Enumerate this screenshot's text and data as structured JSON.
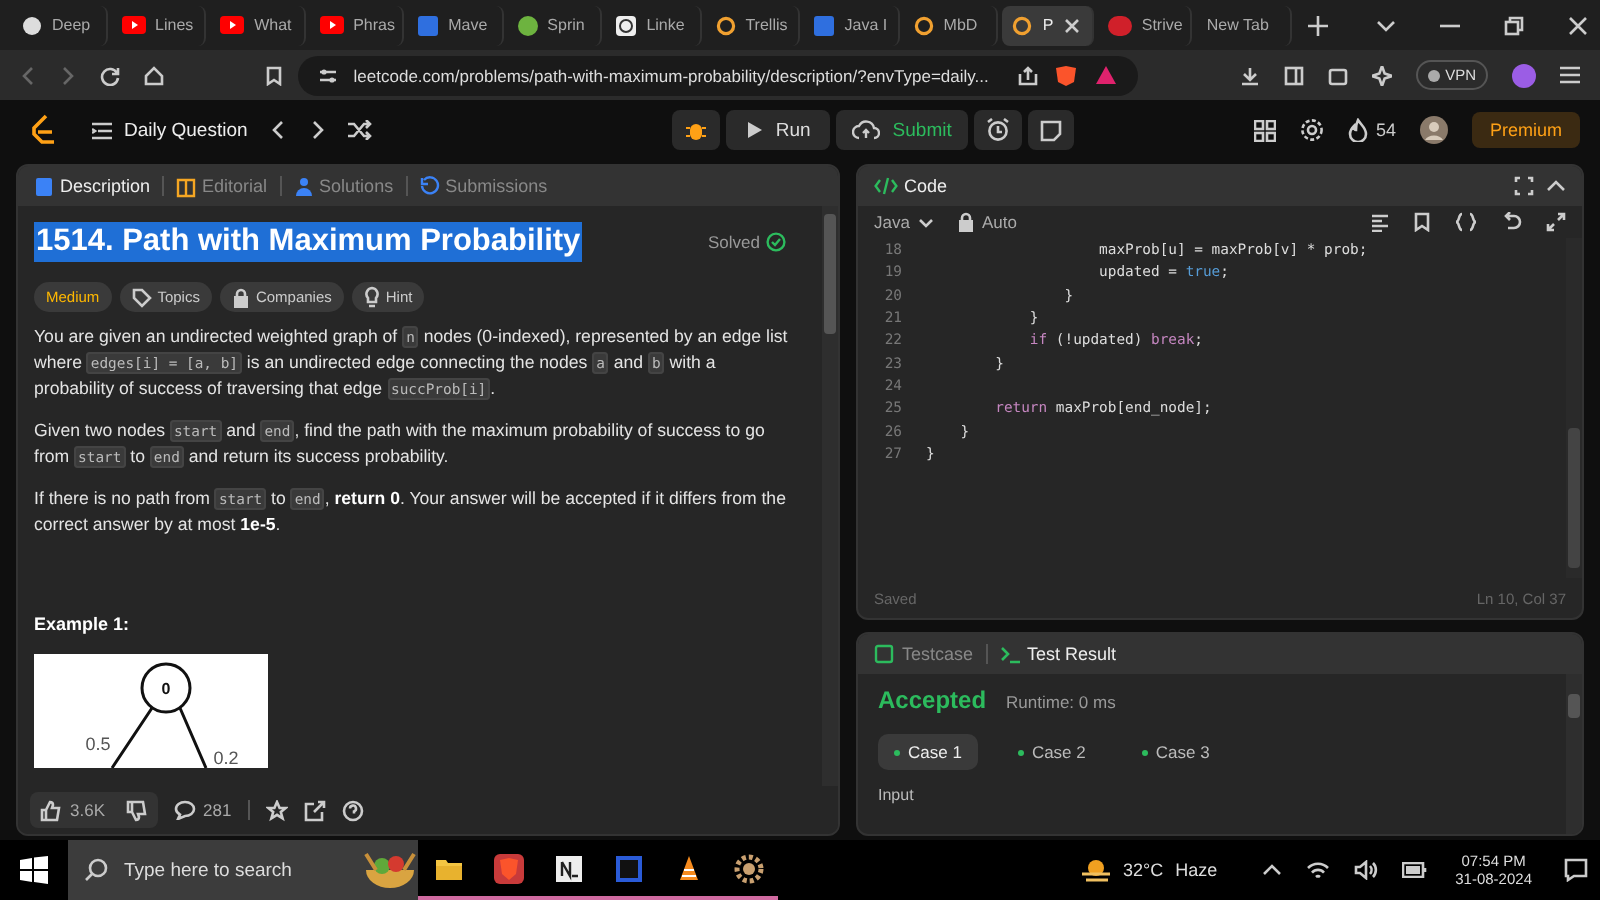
{
  "browser": {
    "tabs": [
      {
        "title": "Deep",
        "selected": false
      },
      {
        "title": "Lines",
        "selected": false
      },
      {
        "title": "What",
        "selected": false
      },
      {
        "title": "Phras",
        "selected": false
      },
      {
        "title": "Mave",
        "selected": false
      },
      {
        "title": "Sprin",
        "selected": false
      },
      {
        "title": "Linke",
        "selected": false
      },
      {
        "title": "Trellis",
        "selected": false
      },
      {
        "title": "Java I",
        "selected": false
      },
      {
        "title": "MbD",
        "selected": false
      },
      {
        "title": "P",
        "selected": true
      },
      {
        "title": "Strive",
        "selected": false
      },
      {
        "title": "New Tab",
        "selected": false
      }
    ],
    "url": "leetcode.com/problems/path-with-maximum-probability/description/?envType=daily...",
    "vpn": "VPN"
  },
  "nav": {
    "title": "Daily Question",
    "run": "Run",
    "submit": "Submit",
    "streak": "54",
    "premium": "Premium"
  },
  "description": {
    "tabs": [
      {
        "label": "Description",
        "selected": true
      },
      {
        "label": "Editorial",
        "selected": false
      },
      {
        "label": "Solutions",
        "selected": false
      },
      {
        "label": "Submissions",
        "selected": false
      }
    ],
    "title": "1514. Path with Maximum Probability",
    "status": "Solved",
    "tags": [
      {
        "label": "Medium",
        "kind": "difficulty"
      },
      {
        "label": "Topics",
        "kind": "topics"
      },
      {
        "label": "Companies",
        "kind": "companies"
      },
      {
        "label": "Hint",
        "kind": "hint"
      }
    ],
    "paragraphs": [
      [
        {
          "kind": "plain",
          "text": "You are given an undirected weighted graph of "
        },
        {
          "kind": "code",
          "text": "n"
        },
        {
          "kind": "plain",
          "text": " nodes (0-indexed), represented by an edge list where "
        },
        {
          "kind": "code",
          "text": "edges[i] = [a, b]"
        },
        {
          "kind": "plain",
          "text": " is an undirected edge connecting the nodes "
        },
        {
          "kind": "code",
          "text": "a"
        },
        {
          "kind": "plain",
          "text": " and "
        },
        {
          "kind": "code",
          "text": "b"
        },
        {
          "kind": "plain",
          "text": " with a probability of success of traversing that edge "
        },
        {
          "kind": "code",
          "text": "succProb[i]"
        },
        {
          "kind": "plain",
          "text": "."
        }
      ],
      [
        {
          "kind": "plain",
          "text": "Given two nodes "
        },
        {
          "kind": "code",
          "text": "start"
        },
        {
          "kind": "plain",
          "text": " and "
        },
        {
          "kind": "code",
          "text": "end"
        },
        {
          "kind": "plain",
          "text": ", find the path with the maximum probability of success to go from "
        },
        {
          "kind": "code",
          "text": "start"
        },
        {
          "kind": "plain",
          "text": " to "
        },
        {
          "kind": "code",
          "text": "end"
        },
        {
          "kind": "plain",
          "text": " and return its success probability."
        }
      ],
      [
        {
          "kind": "plain",
          "text": "If there is no path from "
        },
        {
          "kind": "code",
          "text": "start"
        },
        {
          "kind": "plain",
          "text": " to "
        },
        {
          "kind": "code",
          "text": "end"
        },
        {
          "kind": "plain",
          "text": ", "
        },
        {
          "kind": "bold",
          "text": "return 0"
        },
        {
          "kind": "plain",
          "text": ". Your answer will be accepted if it differs from the correct answer by at most "
        },
        {
          "kind": "bold",
          "text": "1e-5"
        },
        {
          "kind": "plain",
          "text": "."
        }
      ]
    ],
    "example_title": "Example 1:",
    "example_graph": {
      "node": "0",
      "left_weight": "0.5",
      "right_weight": "0.2"
    },
    "likes": "3.6K",
    "comments": "281"
  },
  "editor": {
    "title": "Code",
    "language": "Java",
    "mode": "Auto",
    "lines": [
      {
        "number": "18",
        "tokens": [
          {
            "kind": "plain",
            "text": "                    maxProb[u] = maxProb[v] * prob;"
          }
        ]
      },
      {
        "number": "19",
        "tokens": [
          {
            "kind": "plain",
            "text": "                    updated = "
          },
          {
            "kind": "literal",
            "text": "true"
          },
          {
            "kind": "plain",
            "text": ";"
          }
        ]
      },
      {
        "number": "20",
        "tokens": [
          {
            "kind": "plain",
            "text": "                }"
          }
        ]
      },
      {
        "number": "21",
        "tokens": [
          {
            "kind": "plain",
            "text": "            }"
          }
        ]
      },
      {
        "number": "22",
        "tokens": [
          {
            "kind": "keyword",
            "text": "            if"
          },
          {
            "kind": "plain",
            "text": " (!updated) "
          },
          {
            "kind": "keyword",
            "text": "break"
          },
          {
            "kind": "plain",
            "text": ";"
          }
        ]
      },
      {
        "number": "23",
        "tokens": [
          {
            "kind": "plain",
            "text": "        }"
          }
        ]
      },
      {
        "number": "24"
      },
      {
        "number": "25",
        "tokens": [
          {
            "kind": "keyword",
            "text": "        return"
          },
          {
            "kind": "plain",
            "text": " maxProb[end_node];"
          }
        ]
      },
      {
        "number": "26",
        "tokens": [
          {
            "kind": "plain",
            "text": "    }"
          }
        ]
      },
      {
        "number": "27",
        "tokens": [
          {
            "kind": "plain",
            "text": "}"
          }
        ]
      }
    ],
    "saved": "Saved",
    "cursor": "Ln 10, Col 37"
  },
  "results": {
    "tabs": [
      {
        "label": "Testcase",
        "selected": false
      },
      {
        "label": "Test Result",
        "selected": true
      }
    ],
    "verdict": "Accepted",
    "runtime": "Runtime: 0 ms",
    "cases": [
      {
        "label": "Case 1",
        "selected": true
      },
      {
        "label": "Case 2",
        "selected": false
      },
      {
        "label": "Case 3",
        "selected": false
      }
    ],
    "input_label": "Input"
  },
  "taskbar": {
    "search_placeholder": "Type here to search",
    "weather": "32°C",
    "condition": "Haze",
    "time": "07:54 PM",
    "date": "31-08-2024"
  }
}
